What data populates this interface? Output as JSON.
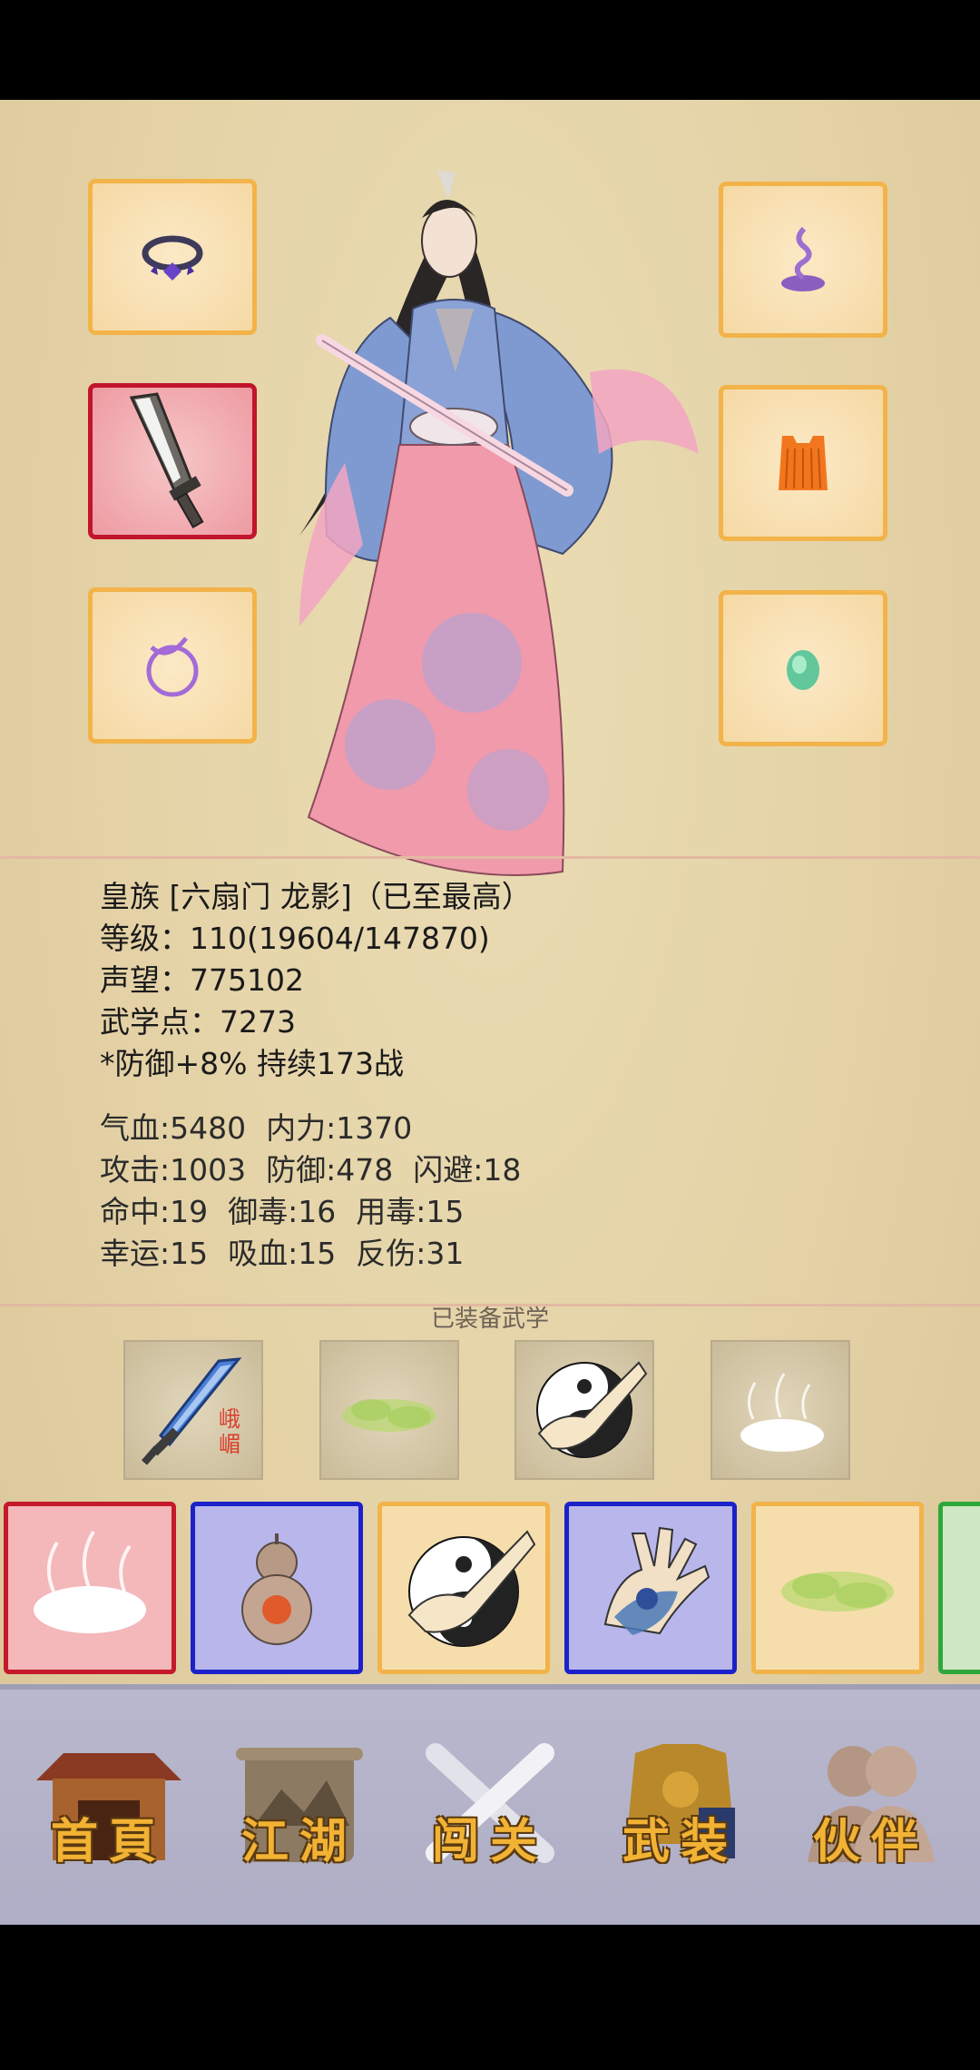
{
  "equipment": {
    "slots": [
      {
        "name": "ring-slot",
        "icon": "ring-icon"
      },
      {
        "name": "weapon-slot",
        "icon": "broadsword-icon"
      },
      {
        "name": "amulet-slot",
        "icon": "ribbon-charm-icon"
      },
      {
        "name": "helmet-slot",
        "icon": "purple-incense-icon"
      },
      {
        "name": "armor-slot",
        "icon": "orange-armor-icon"
      },
      {
        "name": "accessory-slot",
        "icon": "jade-stone-icon"
      }
    ]
  },
  "character": {
    "title_line": "皇族 [六扇门 龙影]（已至最高）",
    "level_line": "等级：110(19604/147870)",
    "reputation_line": "声望：775102",
    "martial_points_line": "武学点：7273",
    "buff_line": "*防御+8% 持续173战"
  },
  "stats": {
    "row1": [
      "气血:5480",
      "内力:1370"
    ],
    "row2": [
      "攻击:1003",
      "防御:478",
      "闪避:18"
    ],
    "row3": [
      "命中:19",
      "御毒:16",
      "用毒:15"
    ],
    "row4": [
      "幸运:15",
      "吸血:15",
      "反伤:31"
    ]
  },
  "equipped_skills": {
    "title": "已装备武学",
    "items": [
      {
        "icon": "sword-skill-icon",
        "text": "峨嵋"
      },
      {
        "icon": "green-mist-icon",
        "text": ""
      },
      {
        "icon": "taiji-fist-icon",
        "text": ""
      },
      {
        "icon": "white-cloud-icon",
        "text": ""
      }
    ]
  },
  "skill_cards": [
    {
      "icon": "white-cloud-icon",
      "border": "#c41a2b",
      "bg": "#f4b7ba"
    },
    {
      "icon": "gourd-icon",
      "border": "#1b22c9",
      "bg": "#b8b6ea"
    },
    {
      "icon": "taiji-fist-icon",
      "border": "#f2b349",
      "bg": "#f6deac"
    },
    {
      "icon": "poison-palm-icon",
      "border": "#1b22c9",
      "bg": "#b8b6ea"
    },
    {
      "icon": "green-mist-icon",
      "border": "#f2b349",
      "bg": "#f6deac"
    },
    {
      "icon": "partial-card-icon",
      "border": "#2ea83a",
      "bg": "#cfe7c4"
    }
  ],
  "nav": {
    "items": [
      {
        "label": "首頁",
        "icon": "house-icon"
      },
      {
        "label": "江湖",
        "icon": "scroll-icon"
      },
      {
        "label": "闯关",
        "icon": "crossed-swords-icon"
      },
      {
        "label": "武装",
        "icon": "armor-icon"
      },
      {
        "label": "伙伴",
        "icon": "partners-icon"
      }
    ]
  }
}
